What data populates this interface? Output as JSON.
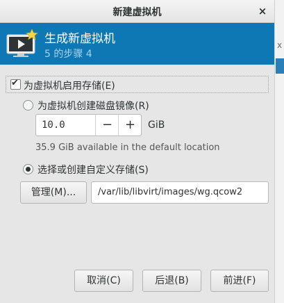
{
  "window": {
    "title": "新建虚拟机",
    "close_glyph": "×"
  },
  "banner": {
    "heading": "生成新虚拟机",
    "step": "5 的步骤 4"
  },
  "storage": {
    "enable_label": "为虚拟机启用存储(E)",
    "enable_checked": true,
    "create_disk_label": "为虚拟机创建磁盘镜像(R)",
    "create_disk_selected": false,
    "size_value": "10.0",
    "size_unit": "GiB",
    "decrement_glyph": "−",
    "increment_glyph": "+",
    "available_text": "35.9 GiB available in the default location",
    "custom_label": "选择或创建自定义存储(S)",
    "custom_selected": true,
    "manage_button": "管理(M)...",
    "custom_path": "/var/lib/libvirt/images/wg.qcow2"
  },
  "footer": {
    "cancel": "取消(C)",
    "back": "后退(B)",
    "forward": "前进(F)"
  },
  "icons": {
    "banner": "monitor-with-star-icon",
    "close": "close-icon"
  },
  "colors": {
    "banner_bg": "#0e78b4",
    "window_bg": "#e6e6e6"
  }
}
